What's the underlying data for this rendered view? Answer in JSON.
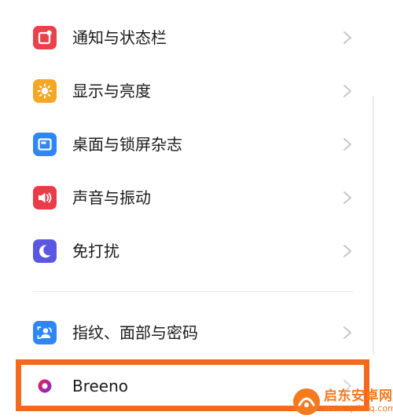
{
  "settings_list": {
    "items": [
      {
        "label": "通知与状态栏",
        "icon": "notification-bar-icon",
        "color": "#e8434a"
      },
      {
        "label": "显示与亮度",
        "icon": "brightness-sun-icon",
        "color": "#f5a623"
      },
      {
        "label": "桌面与锁屏杂志",
        "icon": "wallpaper-picture-icon",
        "color": "#2f86f6"
      },
      {
        "label": "声音与振动",
        "icon": "speaker-icon",
        "color": "#ea3b49"
      },
      {
        "label": "免打扰",
        "icon": "moon-icon",
        "color": "#5b57e0"
      },
      {
        "label": "指纹、面部与密码",
        "icon": "face-fingerprint-icon",
        "color": "#2f86f6"
      },
      {
        "label": "Breeno",
        "icon": "breeno-icon",
        "color": "#b3249f"
      }
    ]
  },
  "highlight": {
    "color": "#f26a1f"
  },
  "watermark": {
    "title": "启东安卓网",
    "url": "www.qdltdq.com",
    "color": "#f47a20"
  }
}
